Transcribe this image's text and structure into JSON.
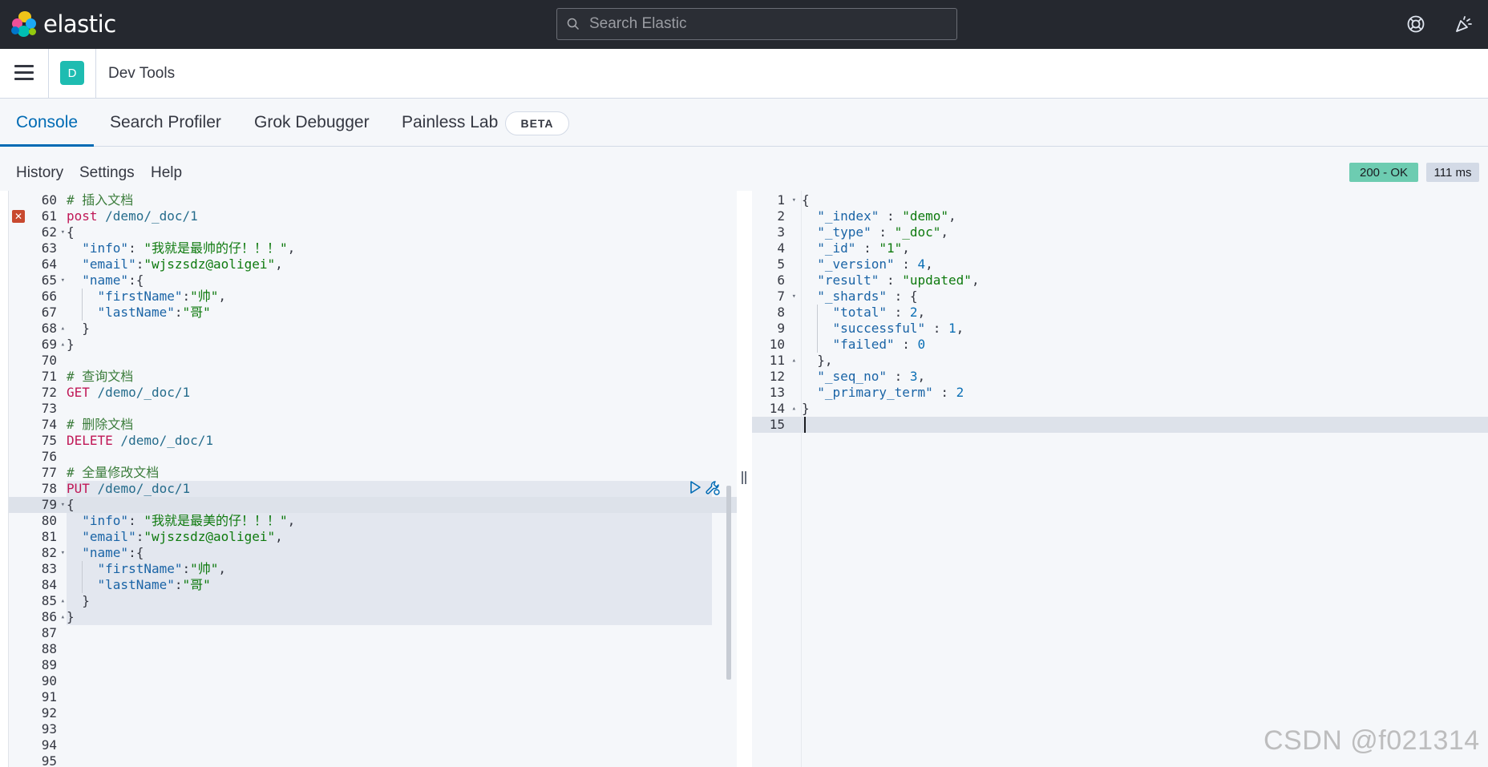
{
  "header": {
    "brand": "elastic",
    "search_placeholder": "Search Elastic"
  },
  "subheader": {
    "space_initial": "D",
    "title": "Dev Tools"
  },
  "tabs": [
    {
      "label": "Console",
      "active": true
    },
    {
      "label": "Search Profiler"
    },
    {
      "label": "Grok Debugger"
    },
    {
      "label": "Painless Lab"
    }
  ],
  "beta_badge": "BETA",
  "toolbar": {
    "history": "History",
    "settings": "Settings",
    "help": "Help",
    "status": "200 - OK",
    "time": "111 ms"
  },
  "request_editor": {
    "line_numbers": [
      "60",
      "61",
      "62",
      "63",
      "64",
      "65",
      "66",
      "67",
      "68",
      "69",
      "70",
      "71",
      "72",
      "73",
      "74",
      "75",
      "76",
      "77",
      "78",
      "79",
      "80",
      "81",
      "82",
      "83",
      "84",
      "85",
      "86",
      "87",
      "88",
      "89",
      "90",
      "91",
      "92",
      "93",
      "94",
      "95"
    ],
    "lines": [
      [
        [
          "c-comment",
          "# 插入文档"
        ]
      ],
      [
        [
          "c-method",
          "post"
        ],
        [
          "c-url",
          " /demo/_doc/1"
        ]
      ],
      [
        [
          "c-punc",
          "{"
        ]
      ],
      [
        [
          "c-punc",
          "  "
        ],
        [
          "c-key",
          "\"info\""
        ],
        [
          "c-punc",
          ": "
        ],
        [
          "c-str",
          "\"我就是最帅的仔！！！\""
        ],
        [
          "c-punc",
          ","
        ]
      ],
      [
        [
          "c-punc",
          "  "
        ],
        [
          "c-key",
          "\"email\""
        ],
        [
          "c-punc",
          ":"
        ],
        [
          "c-str",
          "\"wjszsdz@aoligei\""
        ],
        [
          "c-punc",
          ","
        ]
      ],
      [
        [
          "c-punc",
          "  "
        ],
        [
          "c-key",
          "\"name\""
        ],
        [
          "c-punc",
          ":{"
        ]
      ],
      [
        [
          "c-punc",
          "    "
        ],
        [
          "c-key",
          "\"firstName\""
        ],
        [
          "c-punc",
          ":"
        ],
        [
          "c-str",
          "\"帅\""
        ],
        [
          "c-punc",
          ","
        ]
      ],
      [
        [
          "c-punc",
          "    "
        ],
        [
          "c-key",
          "\"lastName\""
        ],
        [
          "c-punc",
          ":"
        ],
        [
          "c-str",
          "\"哥\""
        ]
      ],
      [
        [
          "c-punc",
          "  }"
        ]
      ],
      [
        [
          "c-punc",
          "}"
        ]
      ],
      [],
      [
        [
          "c-comment",
          "# 查询文档"
        ]
      ],
      [
        [
          "c-method",
          "GET"
        ],
        [
          "c-url",
          " /demo/_doc/1"
        ]
      ],
      [],
      [
        [
          "c-comment",
          "# 删除文档"
        ]
      ],
      [
        [
          "c-method",
          "DELETE"
        ],
        [
          "c-url",
          " /demo/_doc/1"
        ]
      ],
      [],
      [
        [
          "c-comment",
          "# 全量修改文档"
        ]
      ],
      [
        [
          "c-method",
          "PUT"
        ],
        [
          "c-url",
          " /demo/_doc/1"
        ]
      ],
      [
        [
          "c-punc",
          "{"
        ]
      ],
      [
        [
          "c-punc",
          "  "
        ],
        [
          "c-key",
          "\"info\""
        ],
        [
          "c-punc",
          ": "
        ],
        [
          "c-str",
          "\"我就是最美的仔！！！\""
        ],
        [
          "c-punc",
          ","
        ]
      ],
      [
        [
          "c-punc",
          "  "
        ],
        [
          "c-key",
          "\"email\""
        ],
        [
          "c-punc",
          ":"
        ],
        [
          "c-str",
          "\"wjszsdz@aoligei\""
        ],
        [
          "c-punc",
          ","
        ]
      ],
      [
        [
          "c-punc",
          "  "
        ],
        [
          "c-key",
          "\"name\""
        ],
        [
          "c-punc",
          ":{"
        ]
      ],
      [
        [
          "c-punc",
          "    "
        ],
        [
          "c-key",
          "\"firstName\""
        ],
        [
          "c-punc",
          ":"
        ],
        [
          "c-str",
          "\"帅\""
        ],
        [
          "c-punc",
          ","
        ]
      ],
      [
        [
          "c-punc",
          "    "
        ],
        [
          "c-key",
          "\"lastName\""
        ],
        [
          "c-punc",
          ":"
        ],
        [
          "c-str",
          "\"哥\""
        ]
      ],
      [
        [
          "c-punc",
          "  }"
        ]
      ],
      [
        [
          "c-punc",
          "}"
        ]
      ],
      [],
      [],
      [],
      [],
      [],
      [],
      [],
      [],
      []
    ],
    "fold_down": [
      "62",
      "65",
      "79",
      "82"
    ],
    "fold_up": [
      "68",
      "69",
      "85",
      "86"
    ],
    "error_line": "61",
    "selected_request_lines": "78-86"
  },
  "response_editor": {
    "line_numbers": [
      "1",
      "2",
      "3",
      "4",
      "5",
      "6",
      "7",
      "8",
      "9",
      "10",
      "11",
      "12",
      "13",
      "14",
      "15"
    ],
    "lines": [
      [
        [
          "c-punc",
          "{"
        ]
      ],
      [
        [
          "c-punc",
          "  "
        ],
        [
          "c-key",
          "\"_index\""
        ],
        [
          "c-punc",
          " : "
        ],
        [
          "c-str",
          "\"demo\""
        ],
        [
          "c-punc",
          ","
        ]
      ],
      [
        [
          "c-punc",
          "  "
        ],
        [
          "c-key",
          "\"_type\""
        ],
        [
          "c-punc",
          " : "
        ],
        [
          "c-str",
          "\"_doc\""
        ],
        [
          "c-punc",
          ","
        ]
      ],
      [
        [
          "c-punc",
          "  "
        ],
        [
          "c-key",
          "\"_id\""
        ],
        [
          "c-punc",
          " : "
        ],
        [
          "c-str",
          "\"1\""
        ],
        [
          "c-punc",
          ","
        ]
      ],
      [
        [
          "c-punc",
          "  "
        ],
        [
          "c-key",
          "\"_version\""
        ],
        [
          "c-punc",
          " : "
        ],
        [
          "c-num",
          "4"
        ],
        [
          "c-punc",
          ","
        ]
      ],
      [
        [
          "c-punc",
          "  "
        ],
        [
          "c-key",
          "\"result\""
        ],
        [
          "c-punc",
          " : "
        ],
        [
          "c-str",
          "\"updated\""
        ],
        [
          "c-punc",
          ","
        ]
      ],
      [
        [
          "c-punc",
          "  "
        ],
        [
          "c-key",
          "\"_shards\""
        ],
        [
          "c-punc",
          " : {"
        ]
      ],
      [
        [
          "c-punc",
          "    "
        ],
        [
          "c-key",
          "\"total\""
        ],
        [
          "c-punc",
          " : "
        ],
        [
          "c-num",
          "2"
        ],
        [
          "c-punc",
          ","
        ]
      ],
      [
        [
          "c-punc",
          "    "
        ],
        [
          "c-key",
          "\"successful\""
        ],
        [
          "c-punc",
          " : "
        ],
        [
          "c-num",
          "1"
        ],
        [
          "c-punc",
          ","
        ]
      ],
      [
        [
          "c-punc",
          "    "
        ],
        [
          "c-key",
          "\"failed\""
        ],
        [
          "c-punc",
          " : "
        ],
        [
          "c-num",
          "0"
        ]
      ],
      [
        [
          "c-punc",
          "  },"
        ]
      ],
      [
        [
          "c-punc",
          "  "
        ],
        [
          "c-key",
          "\"_seq_no\""
        ],
        [
          "c-punc",
          " : "
        ],
        [
          "c-num",
          "3"
        ],
        [
          "c-punc",
          ","
        ]
      ],
      [
        [
          "c-punc",
          "  "
        ],
        [
          "c-key",
          "\"_primary_term\""
        ],
        [
          "c-punc",
          " : "
        ],
        [
          "c-num",
          "2"
        ]
      ],
      [
        [
          "c-punc",
          "}"
        ]
      ],
      []
    ],
    "fold_down": [
      "1",
      "7"
    ],
    "fold_up": [
      "11",
      "14"
    ],
    "active_line": "15"
  },
  "watermark": "CSDN @f021314",
  "colors": {
    "header_bg": "#25282f",
    "accent": "#006bb4",
    "space_badge": "#1ebcb1",
    "status_ok": "#6dccb1",
    "error": "#c8492f"
  },
  "icons": [
    "elastic-logo-icon",
    "search-icon",
    "help-lifebuoy-icon",
    "newsfeed-icon",
    "menu-icon",
    "error-icon",
    "run-request-icon",
    "wrench-icon"
  ]
}
